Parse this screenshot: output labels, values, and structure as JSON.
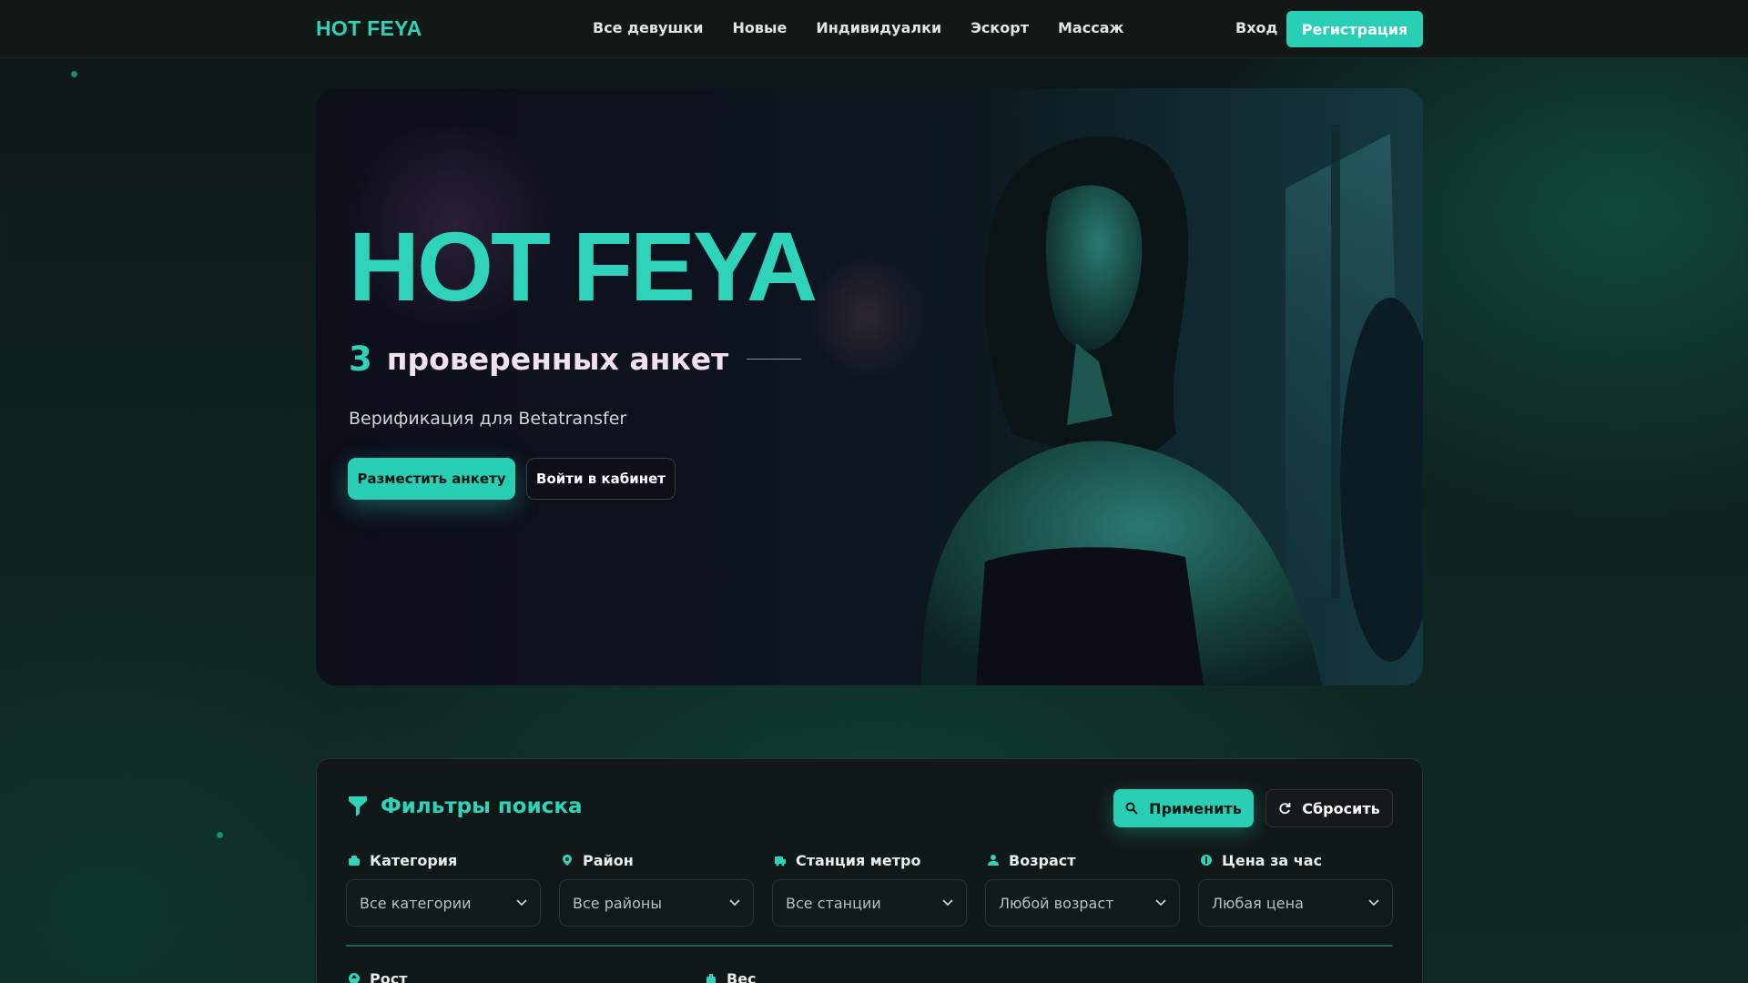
{
  "header": {
    "logo": "HOT FEYA",
    "nav": [
      "Все девушки",
      "Новые",
      "Индивидуалки",
      "Эскорт",
      "Массаж"
    ],
    "login": "Вход",
    "register": "Регистрация"
  },
  "hero": {
    "title": "HOT FEYA",
    "count": "3",
    "count_text": "проверенных анкет",
    "subtitle": "Верификация для Betatransfer",
    "primary_button": "Разместить анкету",
    "secondary_button": "Войти в кабинет"
  },
  "filters": {
    "title": "Фильтры поиска",
    "apply": "Применить",
    "reset": "Сбросить",
    "fields": [
      {
        "label": "Категория",
        "value": "Все категории",
        "icon": "category-icon"
      },
      {
        "label": "Район",
        "value": "Все районы",
        "icon": "location-pin-icon"
      },
      {
        "label": "Станция метро",
        "value": "Все станции",
        "icon": "metro-icon"
      },
      {
        "label": "Возраст",
        "value": "Любой возраст",
        "icon": "user-icon"
      },
      {
        "label": "Цена за час",
        "value": "Любая цена",
        "icon": "price-icon"
      }
    ],
    "row2": [
      {
        "label": "Рост",
        "icon": "height-icon"
      },
      {
        "label": "Вес",
        "icon": "weight-icon"
      }
    ]
  },
  "colors": {
    "accent": "#2ed3ba",
    "background": "#0f1a19",
    "pink_text": "#f1e1f0"
  }
}
